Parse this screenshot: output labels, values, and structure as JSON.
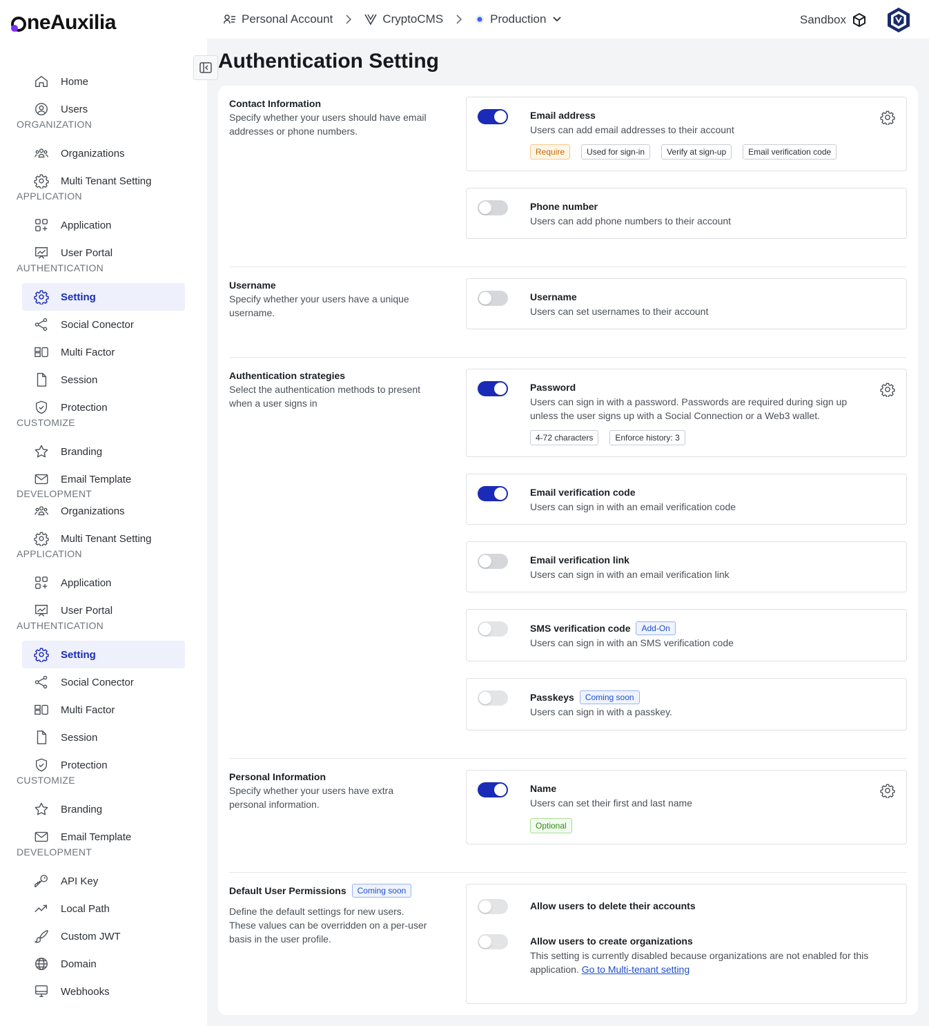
{
  "brand": {
    "name": "neAuxilia"
  },
  "breadcrumb": [
    {
      "label": "Personal Account",
      "icon": "user-list-icon"
    },
    {
      "label": "CryptoCMS",
      "icon": "v-logo-icon"
    },
    {
      "label": "Production",
      "icon": "dot-icon"
    }
  ],
  "topbar": {
    "sandbox_label": "Sandbox"
  },
  "sidebar": {
    "groups": [
      {
        "items": [
          {
            "label": "Home",
            "icon": "home-icon"
          },
          {
            "label": "Users",
            "icon": "user-circle-icon"
          }
        ]
      },
      {
        "heading": "ORGANIZATION",
        "items": [
          {
            "label": "Organizations",
            "icon": "people-icon"
          },
          {
            "label": "Multi Tenant Setting",
            "icon": "gear-icon"
          }
        ]
      },
      {
        "heading": "APPLICATION",
        "items": [
          {
            "label": "Application",
            "icon": "grid-plus-icon"
          },
          {
            "label": "User Portal",
            "icon": "chart-board-icon"
          }
        ]
      },
      {
        "heading": "AUTHENTICATION",
        "items": [
          {
            "label": "Setting",
            "icon": "settings-icon",
            "active": true
          },
          {
            "label": "Social Conector",
            "icon": "share-icon"
          },
          {
            "label": "Multi Factor",
            "icon": "multi-factor-icon"
          },
          {
            "label": "Session",
            "icon": "file-icon"
          },
          {
            "label": "Protection",
            "icon": "shield-icon"
          }
        ]
      },
      {
        "heading": "CUSTOMIZE",
        "items": [
          {
            "label": "Branding",
            "icon": "star-icon"
          },
          {
            "label": "Email Template",
            "icon": "mail-icon"
          }
        ]
      },
      {
        "heading": "DEVELOPMENT",
        "items": [
          {
            "label": "Organizations",
            "icon": "people-icon"
          },
          {
            "label": "Multi Tenant Setting",
            "icon": "gear-icon"
          }
        ]
      },
      {
        "heading": "APPLICATION",
        "items": [
          {
            "label": "Application",
            "icon": "grid-plus-icon"
          },
          {
            "label": "User Portal",
            "icon": "chart-board-icon"
          }
        ]
      },
      {
        "heading": "AUTHENTICATION",
        "items": [
          {
            "label": "Setting",
            "icon": "settings-icon",
            "active": true
          },
          {
            "label": "Social Conector",
            "icon": "share-icon"
          },
          {
            "label": "Multi Factor",
            "icon": "multi-factor-icon"
          },
          {
            "label": "Session",
            "icon": "file-icon"
          },
          {
            "label": "Protection",
            "icon": "shield-icon"
          }
        ]
      },
      {
        "heading": "CUSTOMIZE",
        "items": [
          {
            "label": "Branding",
            "icon": "star-icon"
          },
          {
            "label": "Email Template",
            "icon": "mail-icon"
          }
        ]
      },
      {
        "heading": "DEVELOPMENT",
        "items": [
          {
            "label": "API Key",
            "icon": "key-icon"
          },
          {
            "label": "Local Path",
            "icon": "trend-icon"
          },
          {
            "label": "Custom JWT",
            "icon": "brush-icon"
          },
          {
            "label": "Domain",
            "icon": "globe-icon"
          },
          {
            "label": "Webhooks",
            "icon": "monitor-icon"
          }
        ]
      }
    ]
  },
  "page": {
    "title": "Authentication Setting"
  },
  "sections": {
    "contact": {
      "title": "Contact Information",
      "desc": "Specify whether your users should have email addresses or phone numbers.",
      "options": {
        "email": {
          "title": "Email address",
          "desc": "Users can add email addresses to their account",
          "enabled": true,
          "tags": [
            "Require",
            "Used for sign-in",
            "Verify at sign-up",
            "Email verification code"
          ]
        },
        "phone": {
          "title": "Phone number",
          "desc": "Users can add phone numbers to their account",
          "enabled": false
        }
      }
    },
    "username": {
      "title": "Username",
      "desc": "Specify whether your users have a unique username.",
      "options": {
        "username": {
          "title": "Username",
          "desc": "Users can set usernames to their account",
          "enabled": false
        }
      }
    },
    "strategies": {
      "title": "Authentication strategies",
      "desc": "Select the authentication methods to present when a user signs in",
      "options": {
        "password": {
          "title": "Password",
          "desc": "Users can sign in with a password. Passwords are required during sign up unless the user signs up with a Social Connection or a Web3 wallet.",
          "enabled": true,
          "tags": [
            "4-72 characters",
            "Enforce history: 3"
          ]
        },
        "email_code": {
          "title": "Email verification code",
          "desc": "Users can sign in with an email verification code",
          "enabled": true
        },
        "email_link": {
          "title": "Email verification link",
          "desc": "Users can sign in with an email verification link",
          "enabled": false
        },
        "sms_code": {
          "title": "SMS verification code",
          "badge": "Add-On",
          "desc": "Users can sign in with an SMS verification code",
          "enabled": false
        },
        "passkeys": {
          "title": "Passkeys",
          "badge": "Coming soon",
          "desc": "Users can sign in with a passkey.",
          "enabled": false
        }
      }
    },
    "personal": {
      "title": "Personal Information",
      "desc": "Specify whether your users have extra personal information.",
      "options": {
        "name": {
          "title": "Name",
          "desc": "Users can set their first and last name",
          "enabled": true,
          "tags": [
            "Optional"
          ]
        }
      }
    },
    "permissions": {
      "title": "Default User Permissions",
      "badge": "Coming soon",
      "desc": "Define the default settings for new users. These values can be overridden on a per-user basis in the user profile.",
      "options": {
        "delete": {
          "title": "Allow users to delete their accounts",
          "enabled": false
        },
        "create_org": {
          "title": "Allow users to create organizations",
          "desc": "This setting is currently disabled because organizations are not enabled for this application.",
          "link": "Go to Multi-tenant setting",
          "enabled": false
        }
      }
    }
  },
  "colors": {
    "accent": "#1a2bb8",
    "page_bg": "#f3f4f6",
    "require": "#c46a00",
    "optional": "#2f8a18",
    "badge": "#1f4fc9"
  }
}
